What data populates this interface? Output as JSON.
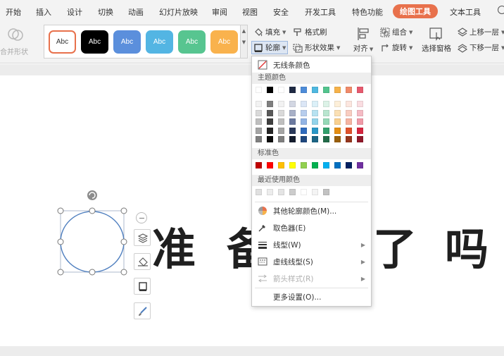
{
  "menu": {
    "items": [
      "开始",
      "插入",
      "设计",
      "切换",
      "动画",
      "幻灯片放映",
      "审阅",
      "视图",
      "安全",
      "开发工具",
      "特色功能",
      "绘图工具",
      "文本工具"
    ],
    "active": "绘图工具"
  },
  "ribbon": {
    "merge_shape": "合并形状",
    "style_label": "Abc",
    "fill": "填充",
    "format_painter": "格式刷",
    "outline": "轮廓",
    "shape_effects": "形状效果",
    "align": "对齐",
    "group": "组合",
    "rotate": "旋转",
    "selection_pane": "选择窗格",
    "bring_forward": "上移一层",
    "send_backward": "下移一层"
  },
  "slide": {
    "chars": [
      "准",
      "备",
      "了",
      "吗"
    ]
  },
  "outline_menu": {
    "no_line": "无线条颜色",
    "theme_colors": "主题颜色",
    "standard_colors": "标准色",
    "recent_colors": "最近使用颜色",
    "more_colors": "其他轮廓颜色(M)...",
    "eyedropper": "取色器(E)",
    "line_style": "线型(W)",
    "dash_style": "虚线线型(S)",
    "arrow_style": "箭头样式(R)",
    "more_settings": "更多设置(O)..."
  },
  "colors": {
    "active_tab": "#e8714c",
    "theme_top": [
      "#ffffff",
      "#000000",
      "#ffffff",
      "#1f2a44",
      "#4e8cd8",
      "#4fb8e0",
      "#53c48e",
      "#f6b24a",
      "#f08a6a",
      "#e65a6e"
    ],
    "theme_shades": [
      [
        "#f2f2f2",
        "#7f7f7f",
        "#f2f2f2",
        "#d3d7e3",
        "#dbe6f6",
        "#dbf0f8",
        "#dcf2e7",
        "#fdefd9",
        "#fce6df",
        "#fadde1"
      ],
      [
        "#d9d9d9",
        "#595959",
        "#d9d9d9",
        "#a8b0c7",
        "#b7cded",
        "#b7e2f1",
        "#b9e5cf",
        "#fbe0b4",
        "#f9cdc0",
        "#f5bbc4"
      ],
      [
        "#bfbfbf",
        "#3f3f3f",
        "#bfbfbf",
        "#6c7aa0",
        "#93b4e4",
        "#93d3ea",
        "#96d8b7",
        "#f9d08f",
        "#f6b4a1",
        "#f09aa7"
      ],
      [
        "#a5a5a5",
        "#262626",
        "#a5a5a5",
        "#2b3a5c",
        "#2f6bbd",
        "#2a97c7",
        "#33a06d",
        "#e58e12",
        "#e0522b",
        "#d6263f"
      ],
      [
        "#7f7f7f",
        "#0c0c0c",
        "#7f7f7f",
        "#151d2e",
        "#1f477e",
        "#1c6585",
        "#226b48",
        "#995f0c",
        "#95361d",
        "#8f192a"
      ]
    ],
    "standard": [
      "#c00000",
      "#ff0000",
      "#ffc000",
      "#ffff00",
      "#92d050",
      "#00b050",
      "#00b0f0",
      "#0070c0",
      "#002060",
      "#7030a0"
    ],
    "recent": [
      "#e0e0e0",
      "#ececec",
      "#e4e4e4",
      "#cccccc",
      "#ffffff",
      "#f4f4f4",
      "#c2c2c2"
    ],
    "swatches": [
      {
        "bg": "#ffffff",
        "fg": "#333333",
        "border": "#e8714c"
      },
      {
        "bg": "#000000",
        "fg": "#ffffff",
        "border": "#000000"
      },
      {
        "bg": "#5b8fdc",
        "fg": "#ffffff",
        "border": "#5b8fdc"
      },
      {
        "bg": "#53b5e3",
        "fg": "#ffffff",
        "border": "#53b5e3"
      },
      {
        "bg": "#57c590",
        "fg": "#ffffff",
        "border": "#57c590"
      },
      {
        "bg": "#f9b24d",
        "fg": "#ffffff",
        "border": "#f9b24d"
      }
    ]
  }
}
